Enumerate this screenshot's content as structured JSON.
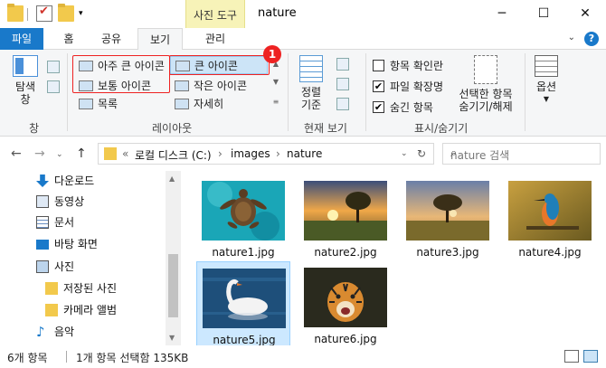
{
  "window": {
    "title": "nature",
    "context_tab": "사진 도구",
    "minimize": "─",
    "maximize": "☐",
    "close": "✕"
  },
  "ribbon_tabs": {
    "file": "파일",
    "home": "홈",
    "share": "공유",
    "view": "보기",
    "manage": "관리"
  },
  "ribbon": {
    "pane": {
      "label_line1": "탐색",
      "label_line2": "창",
      "group": "창"
    },
    "layout": {
      "group": "레이아웃",
      "items": [
        "아주 큰 아이콘",
        "큰 아이콘",
        "보통 아이콘",
        "작은 아이콘",
        "목록",
        "자세히"
      ],
      "selected": "큰 아이콘",
      "callout": "1"
    },
    "current_view": {
      "sort_line1": "정렬",
      "sort_line2": "기준",
      "group": "현재 보기"
    },
    "show_hide": {
      "group": "표시/숨기기",
      "item_checkboxes": {
        "label": "항목 확인란",
        "checked": false
      },
      "file_extensions": {
        "label": "파일 확장명",
        "checked": true
      },
      "hidden_items": {
        "label": "숨긴 항목",
        "checked": true
      },
      "hide_selected_line1": "선택한 항목",
      "hide_selected_line2": "숨기기/해제"
    },
    "options": {
      "label": "옵션"
    }
  },
  "address": {
    "breadcrumbs": [
      "«",
      "로컬 디스크 (C:)",
      "images",
      "nature"
    ],
    "search_placeholder": "nature 검색"
  },
  "nav_pane": {
    "items": [
      {
        "label": "다운로드",
        "icon": "download-icon",
        "indent": 1
      },
      {
        "label": "동영상",
        "icon": "video-icon",
        "indent": 1
      },
      {
        "label": "문서",
        "icon": "document-icon",
        "indent": 1
      },
      {
        "label": "바탕 화면",
        "icon": "desktop-icon",
        "indent": 1
      },
      {
        "label": "사진",
        "icon": "pictures-icon",
        "indent": 1
      },
      {
        "label": "저장된 사진",
        "icon": "folder-icon",
        "indent": 2
      },
      {
        "label": "카메라 앨범",
        "icon": "folder-icon",
        "indent": 2
      },
      {
        "label": "음악",
        "icon": "music-icon",
        "indent": 1
      }
    ]
  },
  "files": [
    {
      "name": "nature1.jpg",
      "subject": "sea-turtle",
      "selected": false
    },
    {
      "name": "nature2.jpg",
      "subject": "sunset-tree",
      "selected": false
    },
    {
      "name": "nature3.jpg",
      "subject": "field-tree",
      "selected": false
    },
    {
      "name": "nature4.jpg",
      "subject": "kingfisher",
      "selected": false
    },
    {
      "name": "nature5.jpg",
      "subject": "swan",
      "selected": true
    },
    {
      "name": "nature6.jpg",
      "subject": "tiger",
      "selected": false
    }
  ],
  "status": {
    "item_count": "6개 항목",
    "selection": "1개 항목 선택함 135KB"
  },
  "colors": {
    "accent": "#1979ca",
    "selection": "#cce8ff",
    "callout": "#e22222"
  }
}
